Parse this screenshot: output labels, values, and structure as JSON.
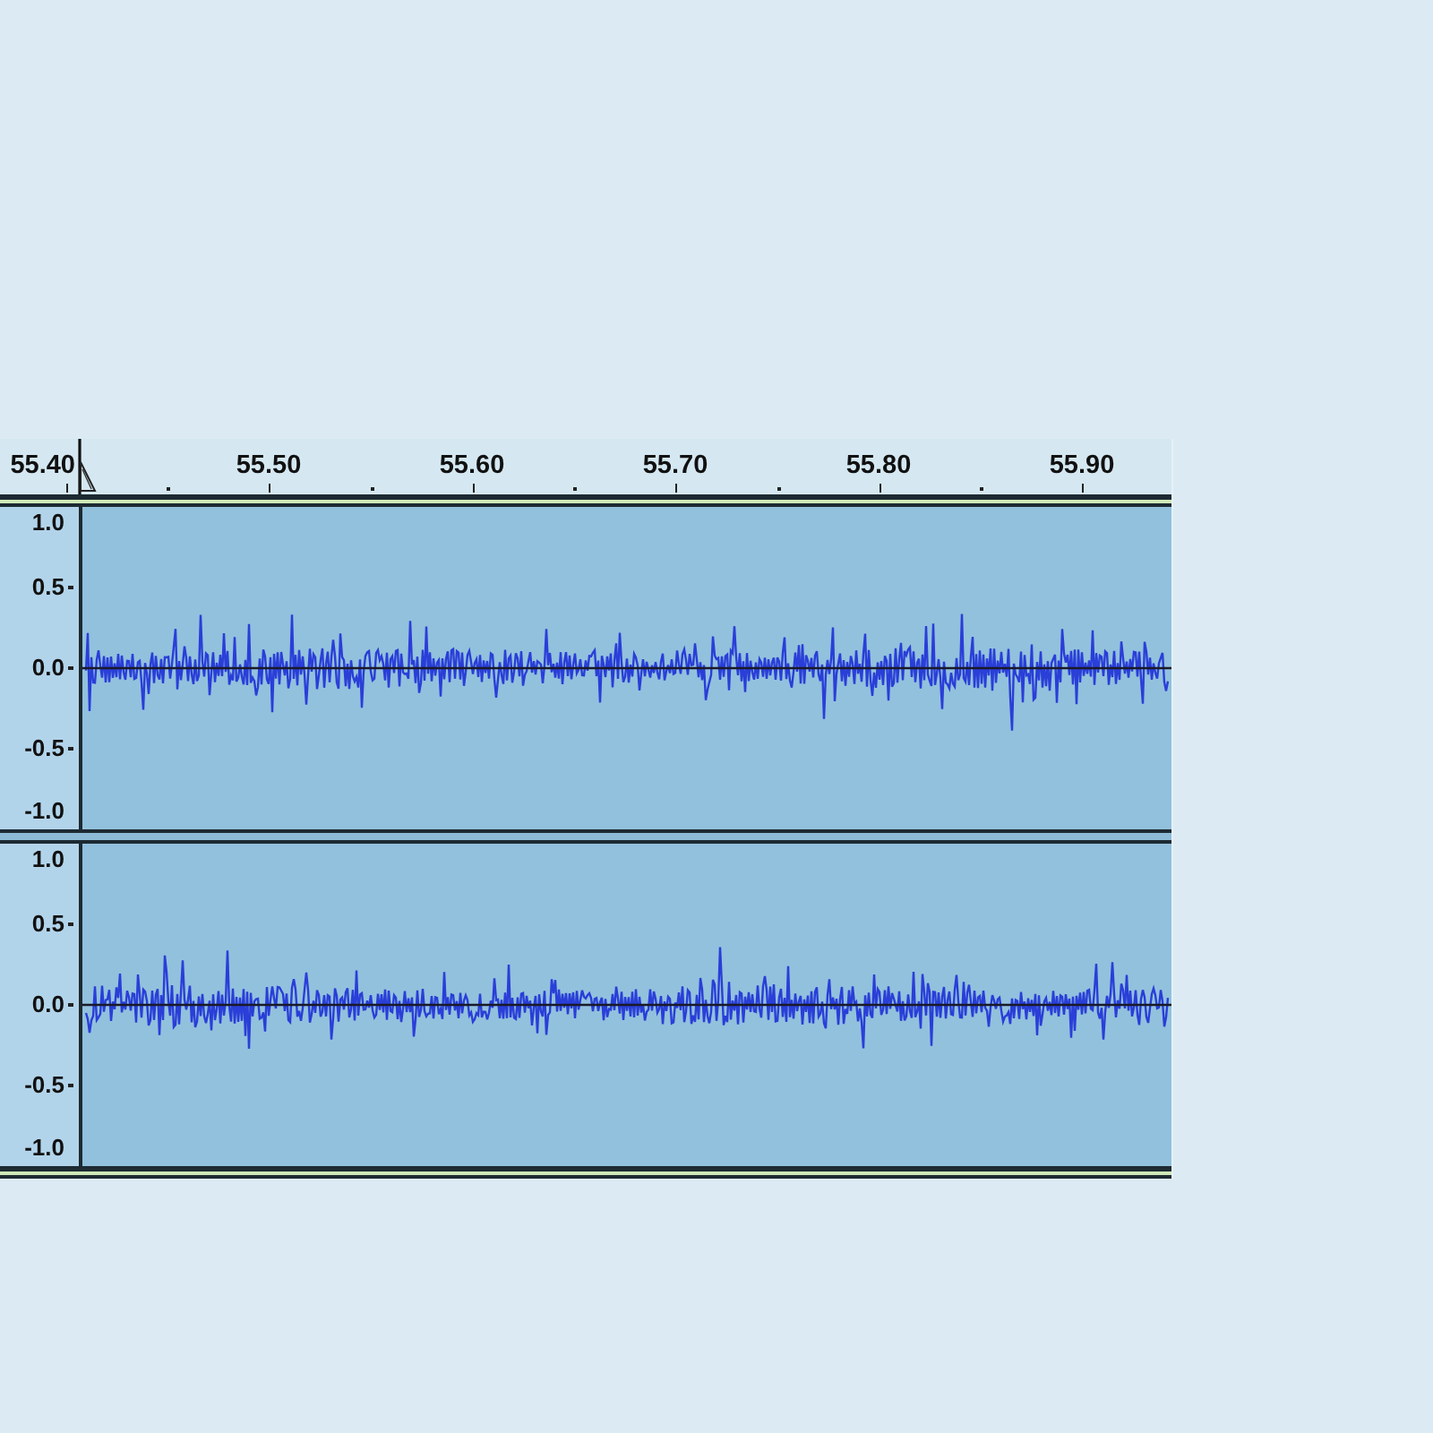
{
  "time_ruler": {
    "labels": [
      "55.40",
      "55.50",
      "55.60",
      "55.70",
      "55.80",
      "55.90"
    ]
  },
  "track": {
    "channels": [
      {
        "scale_labels": [
          "1.0",
          "0.5",
          "0.0",
          "-0.5",
          "-1.0"
        ]
      },
      {
        "scale_labels": [
          "1.0",
          "0.5",
          "0.0",
          "-0.5",
          "-1.0"
        ]
      }
    ]
  }
}
